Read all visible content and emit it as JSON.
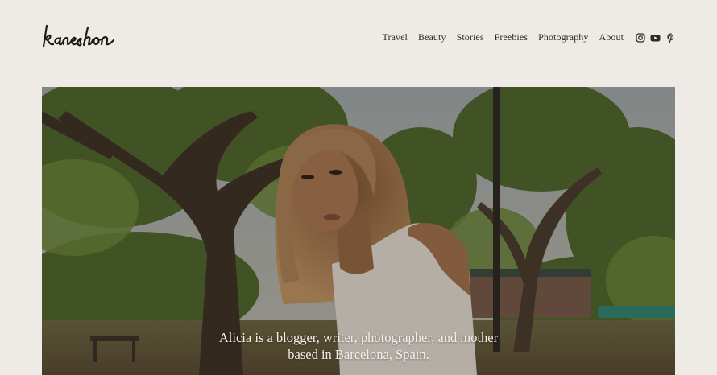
{
  "brand": {
    "logo_text": "kaneshon"
  },
  "nav": {
    "items": [
      {
        "label": "Travel"
      },
      {
        "label": "Beauty"
      },
      {
        "label": "Stories"
      },
      {
        "label": "Freebies"
      },
      {
        "label": "Photography"
      },
      {
        "label": "About"
      }
    ]
  },
  "socials": [
    {
      "icon": "instagram-icon"
    },
    {
      "icon": "youtube-icon"
    },
    {
      "icon": "pinterest-icon"
    }
  ],
  "hero": {
    "caption_line1": "Alicia is a blogger, writer, photographer, and mother",
    "caption_line2": "based in Barcelona, Spain."
  },
  "colors": {
    "background": "#eeeae5",
    "text": "#2f2a26",
    "caption": "#f5f0ea"
  }
}
